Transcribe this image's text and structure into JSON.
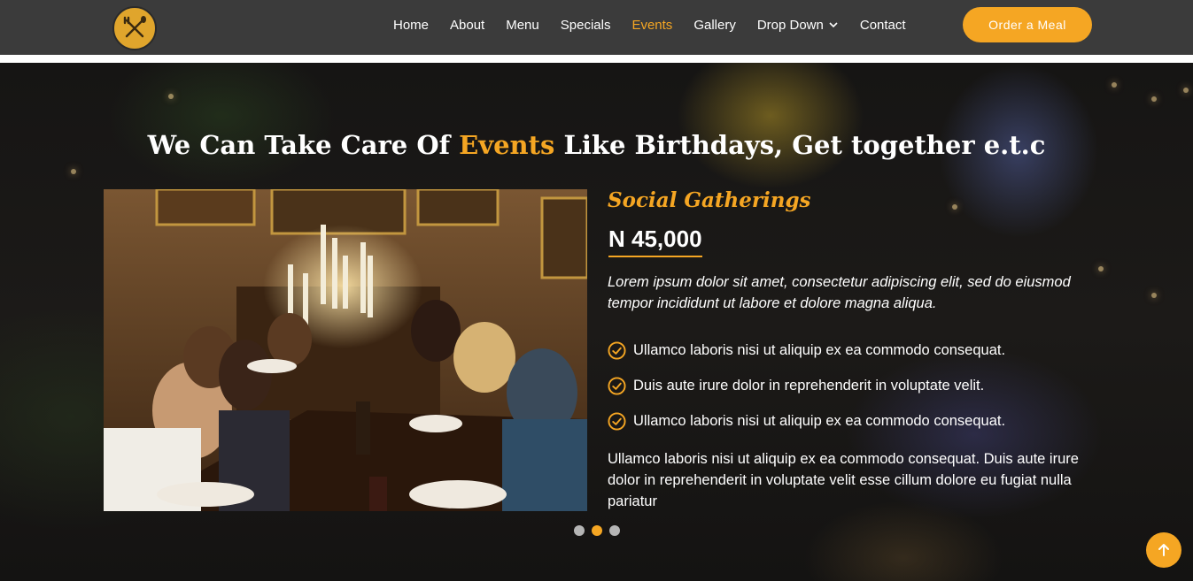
{
  "header": {
    "logo_icon": "fork-knife-crossed-icon",
    "nav": [
      {
        "label": "Home"
      },
      {
        "label": "About"
      },
      {
        "label": "Menu"
      },
      {
        "label": "Specials"
      },
      {
        "label": "Events",
        "active": true
      },
      {
        "label": "Gallery"
      },
      {
        "label": "Drop Down",
        "has_dropdown": true
      },
      {
        "label": "Contact"
      }
    ],
    "cta_label": "Order a Meal"
  },
  "section": {
    "title_before": "We Can Take Care Of ",
    "title_accent": "Events",
    "title_after": " Like Birthdays, Get together e.t.c"
  },
  "event": {
    "name": "Social Gatherings",
    "price": "N 45,000",
    "lead": "Lorem ipsum dolor sit amet, consectetur adipiscing elit, sed do eiusmod tempor incididunt ut labore et dolore magna aliqua.",
    "features": [
      "Ullamco laboris nisi ut aliquip ex ea commodo consequat.",
      "Duis aute irure dolor in reprehenderit in voluptate velit.",
      "Ullamco laboris nisi ut aliquip ex ea commodo consequat."
    ],
    "body": "Ullamco laboris nisi ut aliquip ex ea commodo consequat. Duis aute irure dolor in reprehenderit in voluptate velit esse cillum dolore eu fugiat nulla pariatur",
    "photo_description": "dinner-party-toast-photo"
  },
  "carousel": {
    "count": 3,
    "active_index": 1
  },
  "colors": {
    "accent": "#f5a623",
    "header_bg": "#3b3b3b",
    "text": "#ffffff"
  },
  "icons": {
    "check": "check-circle-icon",
    "scroll_top": "arrow-up-icon",
    "dropdown": "chevron-down-icon"
  }
}
